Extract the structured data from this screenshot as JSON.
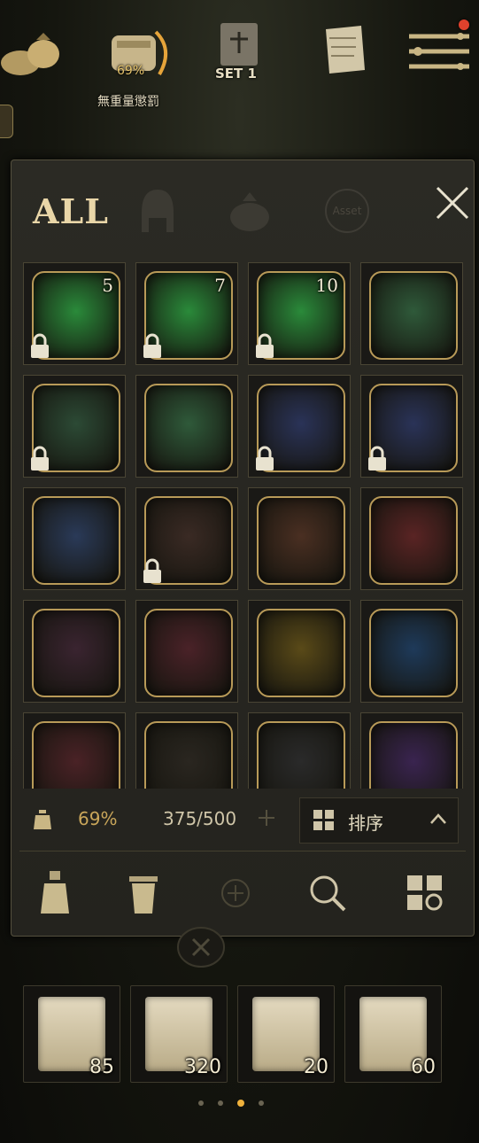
{
  "top": {
    "weight_percent": "69%",
    "weight_caption": "無重量懲罰",
    "set_label": "SET 1"
  },
  "tabs": {
    "all_label": "ALL",
    "asset_label": "Asset"
  },
  "inventory": {
    "slots": [
      {
        "name": "green-potion-watch",
        "count": "5",
        "locked": true,
        "color": "#2a8a3a"
      },
      {
        "name": "green-potion-watch",
        "count": "7",
        "locked": true,
        "color": "#2a8a3a"
      },
      {
        "name": "green-potion-watch",
        "count": "10",
        "locked": true,
        "color": "#2a8a3a"
      },
      {
        "name": "green-book",
        "count": "",
        "locked": false,
        "color": "#2f5a3a"
      },
      {
        "name": "blue-dragon-crest",
        "count": "",
        "locked": true,
        "color": "#2c4a35"
      },
      {
        "name": "silver-mask-crest",
        "count": "",
        "locked": false,
        "color": "#2f5a3a"
      },
      {
        "name": "red-demon-crest",
        "count": "",
        "locked": true,
        "color": "#2a3358"
      },
      {
        "name": "cyan-orb-crest",
        "count": "",
        "locked": true,
        "color": "#2a3358"
      },
      {
        "name": "yin-yang-crest",
        "count": "",
        "locked": false,
        "color": "#2a3a58"
      },
      {
        "name": "bronze-ornament-crest",
        "count": "",
        "locked": true,
        "color": "#3a2a24"
      },
      {
        "name": "bronze-beast-crest",
        "count": "",
        "locked": false,
        "color": "#4a2f22"
      },
      {
        "name": "red-figure-crest",
        "count": "",
        "locked": false,
        "color": "#5a2424"
      },
      {
        "name": "dark-orb-crest",
        "count": "",
        "locked": false,
        "color": "#3a2430"
      },
      {
        "name": "blue-star-crest",
        "count": "",
        "locked": false,
        "color": "#4a2228"
      },
      {
        "name": "gold-skull-crest",
        "count": "",
        "locked": false,
        "color": "#5a4a18"
      },
      {
        "name": "blue-crystal-crest",
        "count": "",
        "locked": false,
        "color": "#1e3a5a"
      },
      {
        "name": "silver-watch-crest",
        "count": "",
        "locked": false,
        "color": "#4a2226"
      },
      {
        "name": "ruby-ornament",
        "count": "",
        "locked": false,
        "color": "#2a2620"
      },
      {
        "name": "silver-blade",
        "count": "",
        "locked": false,
        "color": "#2a2a2a"
      },
      {
        "name": "gold-emblem-crest",
        "count": "",
        "locked": false,
        "color": "#3a2450"
      }
    ]
  },
  "status": {
    "weight_percent": "69%",
    "capacity": "375/500",
    "sort_label": "排序"
  },
  "quickbar": {
    "items": [
      {
        "name": "horn-scroll",
        "count": "85"
      },
      {
        "name": "arrow-scroll",
        "count": "320"
      },
      {
        "name": "shield-scroll",
        "count": "20"
      },
      {
        "name": "home-scroll",
        "count": "60"
      }
    ]
  },
  "colors": {
    "accent_gold": "#c9a65a",
    "panel_bg": "#26251f",
    "notification_red": "#e0412c"
  }
}
